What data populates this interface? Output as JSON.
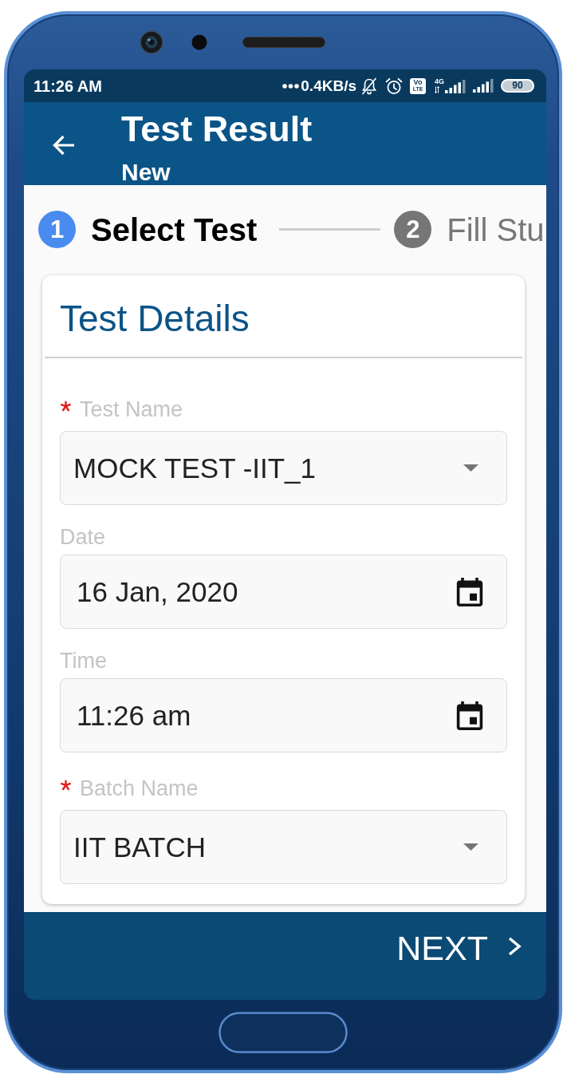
{
  "status_bar": {
    "time": "11:26 AM",
    "network_speed": "0.4KB/s",
    "volte": [
      "Vo",
      "LTE"
    ],
    "network_type": "4G",
    "battery": "90"
  },
  "app_bar": {
    "title": "Test Result",
    "subtitle": "New"
  },
  "stepper": [
    {
      "number": "1",
      "label": "Select Test",
      "selected": true
    },
    {
      "number": "2",
      "label": "Fill Stu",
      "selected": false
    }
  ],
  "card": {
    "title": "Test Details",
    "fields": [
      {
        "kind": "dropdown",
        "label": "Test Name",
        "required": true,
        "value": "MOCK TEST -IIT_1"
      },
      {
        "kind": "picker",
        "label": "Date",
        "required": false,
        "value": "16 Jan, 2020"
      },
      {
        "kind": "picker",
        "label": "Time",
        "required": false,
        "value": "11:26 am"
      },
      {
        "kind": "dropdown",
        "label": "Batch Name",
        "required": true,
        "value": "IIT BATCH"
      }
    ]
  },
  "footer": {
    "next_button": "NEXT"
  }
}
